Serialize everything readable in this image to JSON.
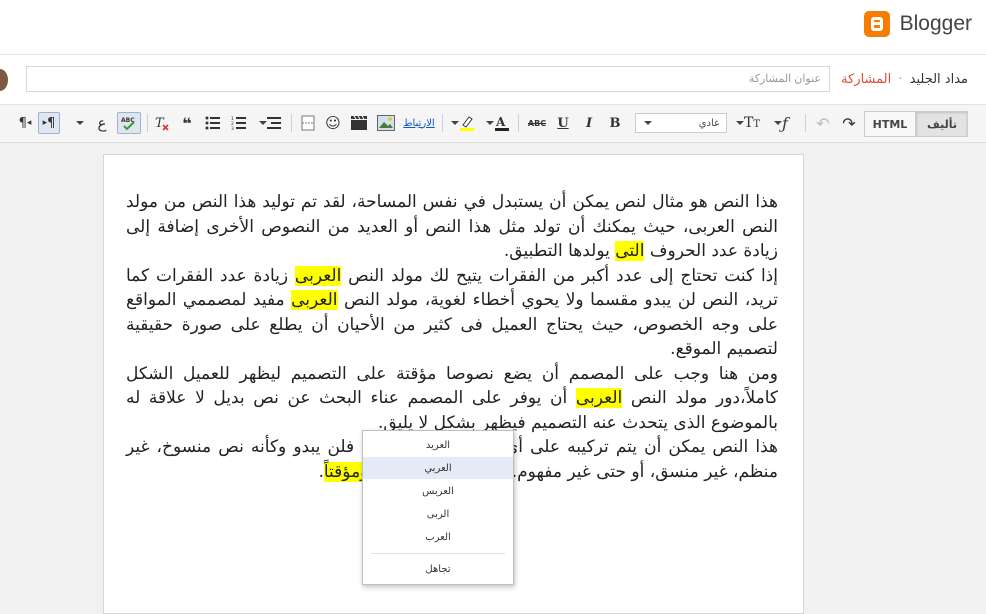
{
  "brand": {
    "name": "Blogger"
  },
  "breadcrumb": {
    "blog": "مداد الجليد",
    "separator": "·",
    "current": "المشاركة"
  },
  "title_input": {
    "placeholder": "عنوان المشاركة",
    "value": ""
  },
  "toolbar": {
    "compose_label": "تأليف",
    "html_label": "HTML",
    "undo_icon": "undo-icon",
    "redo_icon": "redo-icon",
    "font_icon": "font-icon",
    "font_size_icon": "font-size-icon",
    "font_select_value": "عادي",
    "bold": "B",
    "italic": "I",
    "underline": "U",
    "strike": "ABC",
    "link_label": "الارتباط",
    "spell_label": "ABC",
    "ltr_label": "¶",
    "rtl_label": "¶",
    "lang_label": "ع"
  },
  "editor": {
    "segments": [
      {
        "t": "هذا النص هو مثال لنص يمكن أن يستبدل في نفس المساحة، لقد تم توليد هذا النص من مولد النص العربى، حيث يمكنك أن تولد مثل هذا النص أو العديد من النصوص الأخرى إضافة إلى زيادة عدد الحروف "
      },
      {
        "t": "التى",
        "hl": true
      },
      {
        "t": " يولدها التطبيق.",
        "br": true
      },
      {
        "t": "إذا كنت تحتاج إلى عدد أكبر من الفقرات يتيح لك مولد النص "
      },
      {
        "t": "العربى",
        "hl": true
      },
      {
        "t": " زيادة عدد الفقرات كما تريد، النص لن يبدو مقسما ولا يحوي أخطاء لغوية، مولد النص "
      },
      {
        "t": "العربى",
        "hl": true
      },
      {
        "t": " مفيد لمصممي المواقع على وجه الخصوص، حيث يحتاج العميل فى كثير من الأحيان أن يطلع على صورة حقيقية لتصميم الموقع.",
        "br": true
      },
      {
        "t": "ومن هنا وجب على المصمم أن يضع نصوصا مؤقتة على التصميم ليظهر للعميل الشكل كاملاً،دور مولد النص "
      },
      {
        "t": "العربى",
        "hl": true
      },
      {
        "t": " أن يوفر على المصمم عناء البحث عن نص بديل لا علاقة له بالموضوع الذى يتحدث عنه التصميم فيظهر بشكل لا يليق.",
        "br": true
      },
      {
        "t": "هذا النص يمكن أن يتم تركيبه على أي تصميم دون مشكلة فلن يبدو وكأنه نص منسوخ، غير منظم، غير منسق، أو حتى غير مفهوم. لأنه مازال "
      },
      {
        "t": "نصاً",
        "hl": true
      },
      {
        "t": " "
      },
      {
        "t": "بديلاً",
        "hl": true
      },
      {
        "t": " "
      },
      {
        "t": "ومؤقتاً",
        "hl": true
      },
      {
        "t": "."
      }
    ]
  },
  "context_menu": {
    "suggestions": [
      "العريد",
      "العربي",
      "العربس",
      "الربى",
      "العرب"
    ],
    "active_index": 1,
    "ignore_label": "تجاهل"
  }
}
